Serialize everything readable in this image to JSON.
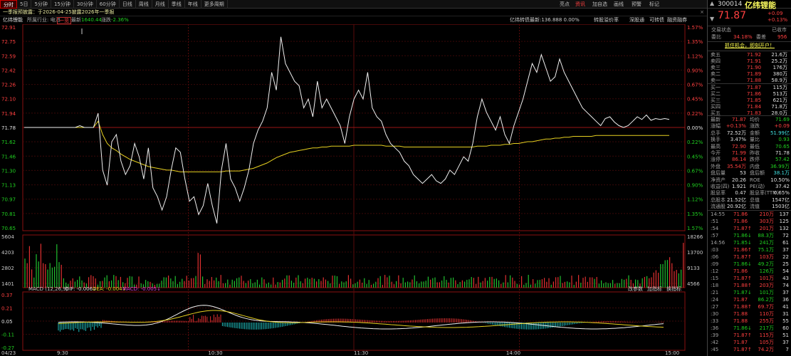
{
  "periods": [
    "分时",
    "5日",
    "5分钟",
    "15分钟",
    "30分钟",
    "60分钟",
    "日线",
    "周线",
    "月线",
    "季线",
    "年线",
    "更多周期"
  ],
  "active_period": "分时",
  "right_tools": [
    "亮点",
    "资讯",
    "加自选",
    "画线",
    "预警",
    "标记"
  ],
  "active_tool": "资讯",
  "notice": {
    "text": "一季报预披露：于2026-04-25披露2026年一季报",
    "close": "×"
  },
  "info": {
    "name": "亿纬锂能",
    "industry": "所属行业: 电池",
    "badge": "一览",
    "latest_label": "最新",
    "latest": "1640.44",
    "change_label": "涨跌",
    "change": "-2.36%",
    "cb_label": "亿纬转债最新:136.888  0.00%",
    "cb2": "转股溢价率",
    "links": [
      "深股通",
      "可转债",
      "融资融券"
    ]
  },
  "price_axis": {
    "left": [
      "72.91",
      "72.75",
      "72.59",
      "72.42",
      "72.26",
      "72.10",
      "71.94",
      "71.78",
      "71.62",
      "71.46",
      "71.30",
      "71.13",
      "70.97",
      "70.81",
      "70.65"
    ],
    "right": [
      "1.57%",
      "1.35%",
      "1.12%",
      "0.90%",
      "0.67%",
      "0.45%",
      "0.22%",
      "0.00%",
      "0.22%",
      "0.45%",
      "0.67%",
      "0.90%",
      "1.12%",
      "1.35%",
      "1.57%"
    ]
  },
  "volume_axis": {
    "left": [
      "5604",
      "4203",
      "2802",
      "1401"
    ],
    "right": [
      "18266",
      "13700",
      "9133",
      "4566"
    ]
  },
  "macd": {
    "label": "MACD (12,26,9)",
    "dif": "DIF: -0.006↓",
    "dea": "DEA: -0.004↓",
    "macd": "MACD: -0.005↓",
    "buttons": [
      "改参数",
      "加指标",
      "换指标"
    ],
    "axis": [
      "0.37",
      "0.21",
      "0.05",
      "-0.11",
      "-0.27"
    ]
  },
  "time_axis": [
    "04/23",
    "9:30",
    "10:30",
    "11:30",
    "14:00",
    "15:00"
  ],
  "chart_data": {
    "type": "line",
    "prev_close": 71.78,
    "price": [
      71.78,
      71.78,
      71.78,
      71.78,
      71.78,
      71.8,
      71.78,
      71.78,
      71.78,
      71.94,
      71.3,
      71.13,
      71.62,
      71.7,
      71.4,
      71.25,
      71.35,
      71.6,
      71.45,
      71.2,
      71.55,
      71.1,
      71.0,
      70.85,
      71.0,
      71.3,
      71.55,
      71.5,
      71.2,
      70.95,
      71.0,
      70.8,
      70.9,
      71.15,
      70.9,
      70.7,
      71.3,
      71.6,
      71.2,
      71.1,
      70.95,
      71.1,
      71.3,
      71.6,
      71.75,
      71.85,
      72.0,
      72.4,
      72.2,
      72.8,
      72.5,
      72.4,
      72.3,
      72.25,
      72.0,
      72.1,
      71.9,
      72.3,
      72.0,
      72.1,
      72.0,
      71.9,
      71.8,
      71.6,
      71.9,
      72.1,
      72.2,
      72.1,
      72.4,
      72.0,
      71.9,
      71.85,
      71.7,
      71.6,
      71.55,
      71.5,
      71.4,
      71.35,
      71.25,
      71.2,
      71.15,
      71.2,
      71.25,
      71.18,
      71.15,
      71.2,
      71.3,
      71.25,
      71.35,
      71.45,
      71.4,
      71.6,
      71.9,
      72.1,
      71.95,
      71.85,
      71.75,
      71.9,
      71.7,
      71.6,
      71.8,
      71.95,
      72.1,
      72.3,
      72.5,
      72.4,
      72.6,
      72.45,
      72.3,
      72.35,
      72.55,
      72.4,
      72.3,
      72.2,
      72.1,
      72.0,
      71.95,
      71.9,
      71.85,
      71.8,
      71.88,
      71.9,
      71.84,
      71.8,
      71.78,
      71.8,
      71.85,
      71.9,
      71.87,
      71.92,
      71.86,
      71.88,
      71.87,
      71.88,
      71.87
    ],
    "avg": [
      71.78,
      71.78,
      71.78,
      71.78,
      71.78,
      71.78,
      71.78,
      71.78,
      71.78,
      71.85,
      71.7,
      71.6,
      71.55,
      71.52,
      71.48,
      71.45,
      71.42,
      71.4,
      71.38,
      71.36,
      71.34,
      71.33,
      71.32,
      71.31,
      71.3,
      71.3,
      71.29,
      71.28,
      71.28,
      71.28,
      71.28,
      71.28,
      71.28,
      71.28,
      71.28,
      71.28,
      71.28,
      71.29,
      71.29,
      71.29,
      71.29,
      71.3,
      71.31,
      71.32,
      71.34,
      71.36,
      71.38,
      71.41,
      71.44,
      71.46,
      71.48,
      71.5,
      71.51,
      71.52,
      71.53,
      71.54,
      71.55,
      71.55,
      71.56,
      71.56,
      71.57,
      71.57,
      71.57,
      71.57,
      71.57,
      71.58,
      71.58,
      71.58,
      71.58,
      71.58,
      71.58,
      71.58,
      71.57,
      71.57,
      71.57,
      71.57,
      71.56,
      71.56,
      71.56,
      71.56,
      71.56,
      71.56,
      71.56,
      71.56,
      71.56,
      71.56,
      71.56,
      71.56,
      71.56,
      71.56,
      71.56,
      71.56,
      71.57,
      71.57,
      71.57,
      71.58,
      71.58,
      71.58,
      71.59,
      71.59,
      71.6,
      71.6,
      71.61,
      71.62,
      71.62,
      71.63,
      71.64,
      71.65,
      71.65,
      71.66,
      71.66,
      71.67,
      71.67,
      71.68,
      71.68,
      71.68,
      71.68,
      71.68,
      71.69,
      71.69,
      71.69,
      71.69,
      71.69,
      71.69,
      71.69,
      71.69,
      71.69,
      71.69,
      71.69,
      71.69,
      71.69,
      71.69,
      71.69,
      71.69,
      71.69
    ],
    "ylim": [
      70.65,
      72.91
    ]
  },
  "rp": {
    "code": "300014",
    "name": "亿纬锂能",
    "price": "71.87",
    "chg1": "+0.09",
    "chg2": "+0.13%",
    "status_label": "交易状态",
    "status": "已收市",
    "wb_label": "委比",
    "wb": "34.18%",
    "wc_label": "委差",
    "wc": "956",
    "promo": "抓住机会，即刻开户！",
    "asks": [
      {
        "l": "卖五",
        "p": "71.92",
        "v": "21.6万"
      },
      {
        "l": "卖四",
        "p": "71.91",
        "v": "25.2万"
      },
      {
        "l": "卖三",
        "p": "71.90",
        "v": "176万"
      },
      {
        "l": "卖二",
        "p": "71.89",
        "v": "380万"
      },
      {
        "l": "卖一",
        "p": "71.88",
        "v": "58.9万"
      }
    ],
    "bids": [
      {
        "l": "买一",
        "p": "71.87",
        "v": "115万"
      },
      {
        "l": "买二",
        "p": "71.86",
        "v": "513万"
      },
      {
        "l": "买三",
        "p": "71.85",
        "v": "621万"
      },
      {
        "l": "买四",
        "p": "71.84",
        "v": "71.8万"
      },
      {
        "l": "买五",
        "p": "71.83",
        "v": "28.0万"
      }
    ],
    "stats": [
      {
        "a": "最新",
        "av": "71.87",
        "ac": "red",
        "b": "均价",
        "bv": "71.69",
        "bc": "green"
      },
      {
        "a": "涨幅",
        "av": "+0.13%",
        "ac": "red",
        "b": "涨跌",
        "bv": "+0.09",
        "bc": "red"
      },
      {
        "a": "总手",
        "av": "72.52万",
        "ac": "white",
        "b": "金额",
        "bv": "51.99亿",
        "bc": "cyan"
      },
      {
        "a": "换手",
        "av": "3.47%",
        "ac": "white",
        "b": "量比",
        "bv": "0.93",
        "bc": "green"
      },
      {
        "a": "最高",
        "av": "72.90",
        "ac": "red",
        "b": "最低",
        "bv": "70.65",
        "bc": "green"
      },
      {
        "a": "今开",
        "av": "71.99",
        "ac": "red",
        "b": "昨收",
        "bv": "71.78",
        "bc": "white"
      },
      {
        "a": "涨停",
        "av": "86.14",
        "ac": "red",
        "b": "跌停",
        "bv": "57.42",
        "bc": "green"
      },
      {
        "a": "外盘",
        "av": "35.54万",
        "ac": "red",
        "b": "内盘",
        "bv": "36.99万",
        "bc": "green"
      },
      {
        "a": "盘后量",
        "av": "53",
        "ac": "white",
        "b": "盘后额",
        "bv": "38.1万",
        "bc": "cyan"
      },
      {
        "a": "净资产",
        "av": "20.26",
        "ac": "white",
        "b": "ROE",
        "bv": "10.50%",
        "bc": "white"
      },
      {
        "a": "收益(四)",
        "av": "1.921",
        "ac": "white",
        "b": "PE(动)",
        "bv": "37.42",
        "bc": "white"
      },
      {
        "a": "股息率",
        "av": "0.47",
        "ac": "white",
        "b": "股息率(TTM)",
        "bv": "0.65%",
        "bc": "white"
      },
      {
        "a": "总股本",
        "av": "21.52亿",
        "ac": "white",
        "b": "总值",
        "bv": "1547亿",
        "bc": "white"
      },
      {
        "a": "流通股",
        "av": "20.92亿",
        "ac": "white",
        "b": "流值",
        "bv": "1503亿",
        "bc": "white"
      }
    ],
    "ticks": [
      {
        "t": "14:55",
        "p": "71.86",
        "pc": "red",
        "v": "210万",
        "vc": "red",
        "n": "137"
      },
      {
        "t": ":51",
        "p": "71.86",
        "pc": "red",
        "v": "303万",
        "vc": "red",
        "n": "125"
      },
      {
        "t": ":54",
        "p": "71.87↑",
        "pc": "red",
        "v": "201万",
        "vc": "red",
        "n": "132"
      },
      {
        "t": ":57",
        "p": "71.86↓",
        "pc": "green",
        "v": "88.3万",
        "vc": "green",
        "n": "72"
      },
      {
        "t": "14:56",
        "p": "71.85↓",
        "pc": "green",
        "v": "241万",
        "vc": "green",
        "n": "61"
      },
      {
        "t": ":03",
        "p": "71.86↑",
        "pc": "red",
        "v": "75.1万",
        "vc": "green",
        "n": "37"
      },
      {
        "t": ":06",
        "p": "71.87↑",
        "pc": "red",
        "v": "103万",
        "vc": "red",
        "n": "22"
      },
      {
        "t": ":09",
        "p": "71.86↓",
        "pc": "green",
        "v": "49.2万",
        "vc": "green",
        "n": "25"
      },
      {
        "t": ":12",
        "p": "71.86",
        "pc": "red",
        "v": "126万",
        "vc": "green",
        "n": "54"
      },
      {
        "t": ":15",
        "p": "71.87↑",
        "pc": "red",
        "v": "101万",
        "vc": "red",
        "n": "43"
      },
      {
        "t": ":18",
        "p": "71.88↑",
        "pc": "red",
        "v": "203万",
        "vc": "red",
        "n": "74"
      },
      {
        "t": ":21",
        "p": "71.87↓",
        "pc": "green",
        "v": "101万",
        "vc": "green",
        "n": "37"
      },
      {
        "t": ":24",
        "p": "71.87",
        "pc": "red",
        "v": "86.2万",
        "vc": "green",
        "n": "36"
      },
      {
        "t": ":27",
        "p": "71.88↑",
        "pc": "red",
        "v": "69.7万",
        "vc": "red",
        "n": "41"
      },
      {
        "t": ":30",
        "p": "71.88",
        "pc": "red",
        "v": "110万",
        "vc": "red",
        "n": "31"
      },
      {
        "t": ":33",
        "p": "71.88",
        "pc": "red",
        "v": "255万",
        "vc": "red",
        "n": "55"
      },
      {
        "t": ":36",
        "p": "71.86↓",
        "pc": "green",
        "v": "217万",
        "vc": "green",
        "n": "60"
      },
      {
        "t": ":39",
        "p": "71.87↑",
        "pc": "red",
        "v": "115万",
        "vc": "red",
        "n": "51"
      },
      {
        "t": ":42",
        "p": "71.87",
        "pc": "red",
        "v": "105万",
        "vc": "red",
        "n": "37"
      },
      {
        "t": ":45",
        "p": "71.87↑",
        "pc": "red",
        "v": "74.2万",
        "vc": "red",
        "n": "7"
      }
    ]
  }
}
